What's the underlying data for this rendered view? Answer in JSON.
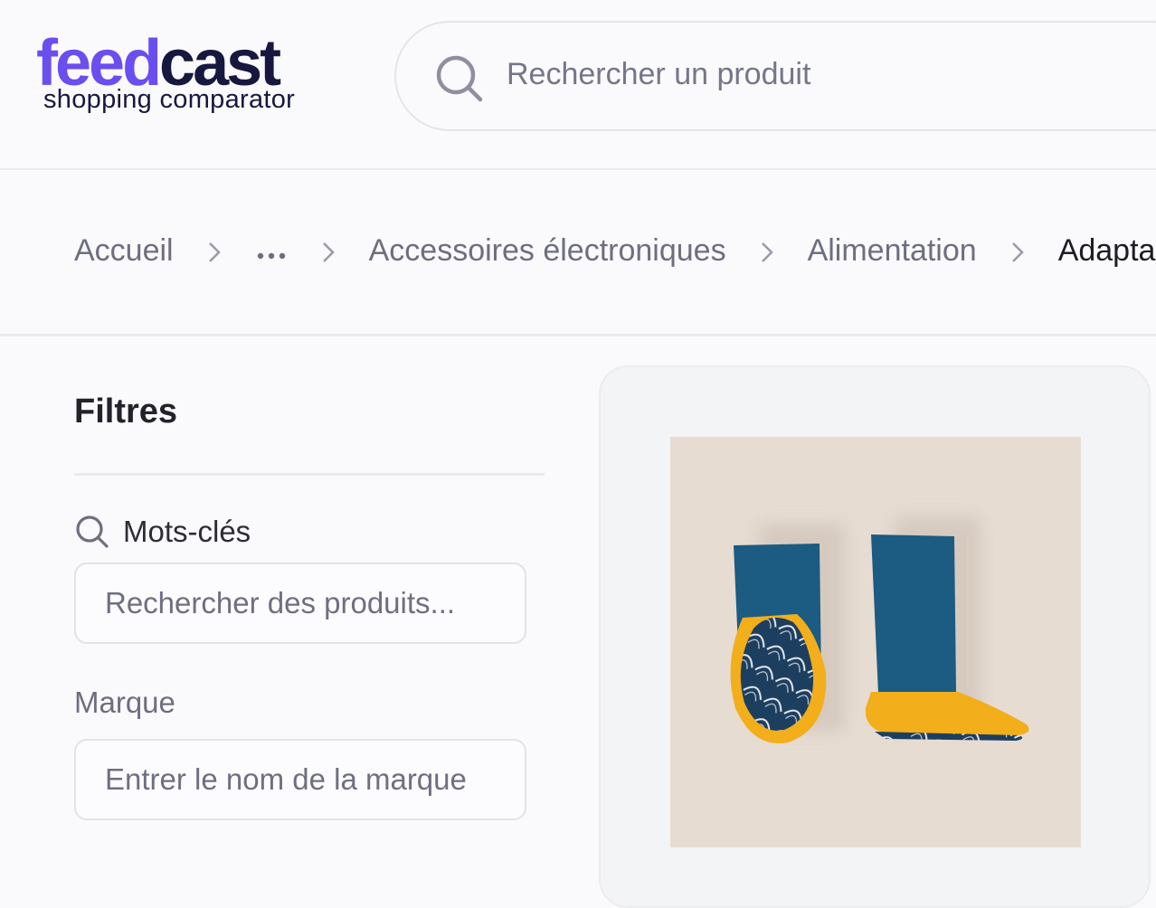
{
  "header": {
    "logo": {
      "brand_part1": "feed",
      "brand_part2": "cast",
      "tagline": "shopping comparator"
    },
    "search": {
      "placeholder": "Rechercher un produit",
      "icon": "search-icon"
    }
  },
  "breadcrumb": {
    "items": [
      "Accueil",
      "…",
      "Accessoires électroniques",
      "Alimentation",
      "Adapta"
    ],
    "separator_icon": "chevron-right-icon"
  },
  "filters": {
    "title": "Filtres",
    "keywords": {
      "label": "Mots-clés",
      "icon": "search-icon",
      "placeholder": "Rechercher des produits..."
    },
    "brand": {
      "label": "Marque",
      "placeholder": "Entrer le nom de la marque"
    }
  },
  "product": {
    "image": "baby-booties-photo"
  },
  "colors": {
    "brand_purple": "#6b4ef0",
    "brand_navy": "#17183f",
    "bootie_blue": "#1c5b82",
    "bootie_yellow": "#f5b21a",
    "image_bg": "#e6dcd2"
  }
}
